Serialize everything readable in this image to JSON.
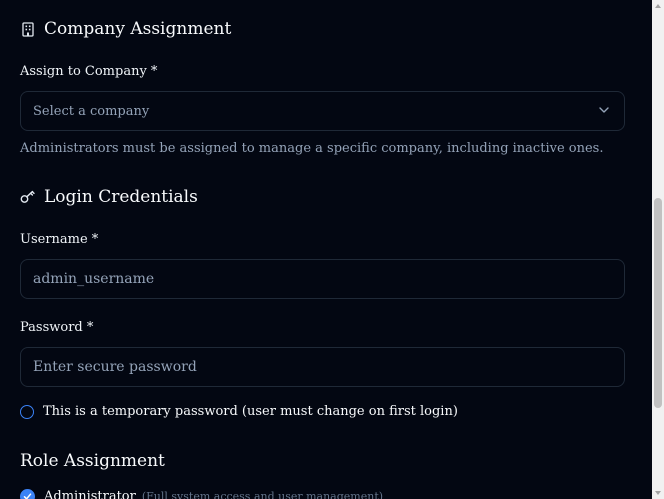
{
  "company_section": {
    "title": "Company Assignment",
    "icon": "building-icon",
    "label": "Assign to Company *",
    "select_value": "Select a company",
    "helper": "Administrators must be assigned to manage a specific company, including inactive ones."
  },
  "login_section": {
    "title": "Login Credentials",
    "icon": "key-icon",
    "username_label": "Username *",
    "username_placeholder": "admin_username",
    "password_label": "Password *",
    "password_placeholder": "Enter secure password",
    "temp_password_label": "This is a temporary password (user must change on first login)"
  },
  "role_section": {
    "title": "Role Assignment",
    "roles": [
      {
        "name": "Administrator",
        "description": "(Full system access and user management)",
        "checked": true
      }
    ]
  },
  "colors": {
    "background": "#030712",
    "border": "#1f2937",
    "accent": "#3b82f6",
    "muted_text": "#94a3b8"
  }
}
